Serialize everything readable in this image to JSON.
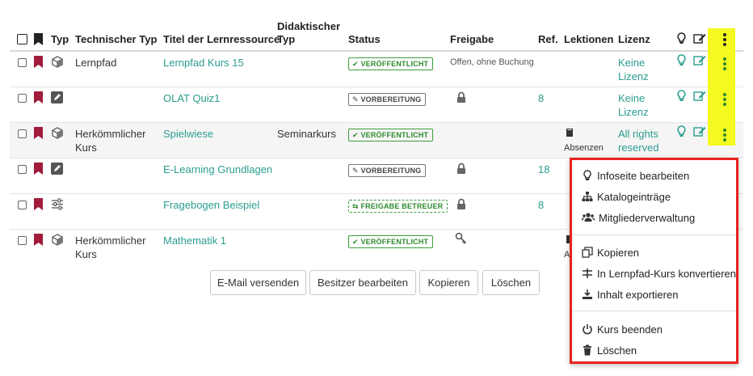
{
  "columns": {
    "typ": "Typ",
    "technischer_typ": "Technischer Typ",
    "titel": "Titel der Lernressource",
    "didaktischer_typ_1": "Didaktischer",
    "didaktischer_typ_2": "Typ",
    "status": "Status",
    "freigabe": "Freigabe",
    "ref": "Ref.",
    "lektionen": "Lektionen",
    "lizenz": "Lizenz"
  },
  "rows": [
    {
      "type_icon": "cube-icon",
      "tech_1": "Lernpfad",
      "tech_2": "",
      "title": "Lernpfad Kurs 15",
      "didactic": "",
      "status": "VERÖFFENTLICHT",
      "freigabe": "Offen, ohne Buchung",
      "ref": "",
      "lektionen": "",
      "lizenz_1": "Keine",
      "lizenz_2": "Lizenz"
    },
    {
      "type_icon": "pencil-icon",
      "tech_1": "",
      "tech_2": "",
      "title": "OLAT Quiz1",
      "didactic": "",
      "status": "VORBEREITUNG",
      "freigabe": "lock-icon",
      "ref": "8",
      "lektionen": "",
      "lizenz_1": "Keine",
      "lizenz_2": "Lizenz"
    },
    {
      "type_icon": "cube-icon",
      "tech_1": "Herkömmlicher",
      "tech_2": "Kurs",
      "title": "Spielwiese",
      "didactic": "Seminarkurs",
      "status": "VERÖFFENTLICHT",
      "freigabe": "",
      "ref": "",
      "lektionen": "Absenzen",
      "lizenz_1": "All rights",
      "lizenz_2": "reserved"
    },
    {
      "type_icon": "pencil-icon",
      "tech_1": "",
      "tech_2": "",
      "title": "E-Learning Grundlagen",
      "didactic": "",
      "status": "VORBEREITUNG",
      "freigabe": "lock-icon",
      "ref": "18",
      "lektionen": "",
      "lizenz_1": "",
      "lizenz_2": ""
    },
    {
      "type_icon": "sliders-icon",
      "tech_1": "",
      "tech_2": "",
      "title": "Fragebogen Beispiel",
      "didactic": "",
      "status": "FREIGABE BETREUER",
      "freigabe": "lock-icon",
      "ref": "8",
      "lektionen": "",
      "lizenz_1": "",
      "lizenz_2": ""
    },
    {
      "type_icon": "cube-icon",
      "tech_1": "Herkömmlicher",
      "tech_2": "Kurs",
      "title": "Mathematik 1",
      "didactic": "",
      "status": "VERÖFFENTLICHT",
      "freigabe": "key-icon",
      "ref": "",
      "lektionen": "",
      "lizenz_1": "",
      "lizenz_2": ""
    }
  ],
  "lektionen_partial": "A",
  "buttons": {
    "email": "E-Mail versenden",
    "besitzer": "Besitzer bearbeiten",
    "kopieren": "Kopieren",
    "loeschen": "Löschen"
  },
  "menu": {
    "infoseite": "Infoseite bearbeiten",
    "katalog": "Katalogeinträge",
    "mitglieder": "Mitgliederverwaltung",
    "kopieren": "Kopieren",
    "konvertieren": "In Lernpfad-Kurs konvertieren",
    "exportieren": "Inhalt exportieren",
    "beenden": "Kurs beenden",
    "loeschen": "Löschen"
  },
  "colors": {
    "link": "#2a9d8f",
    "bookmark": "#a01c3a",
    "status_green": "#2d8a2d",
    "highlight": "#f4f91f",
    "menu_border": "#e8231f"
  }
}
